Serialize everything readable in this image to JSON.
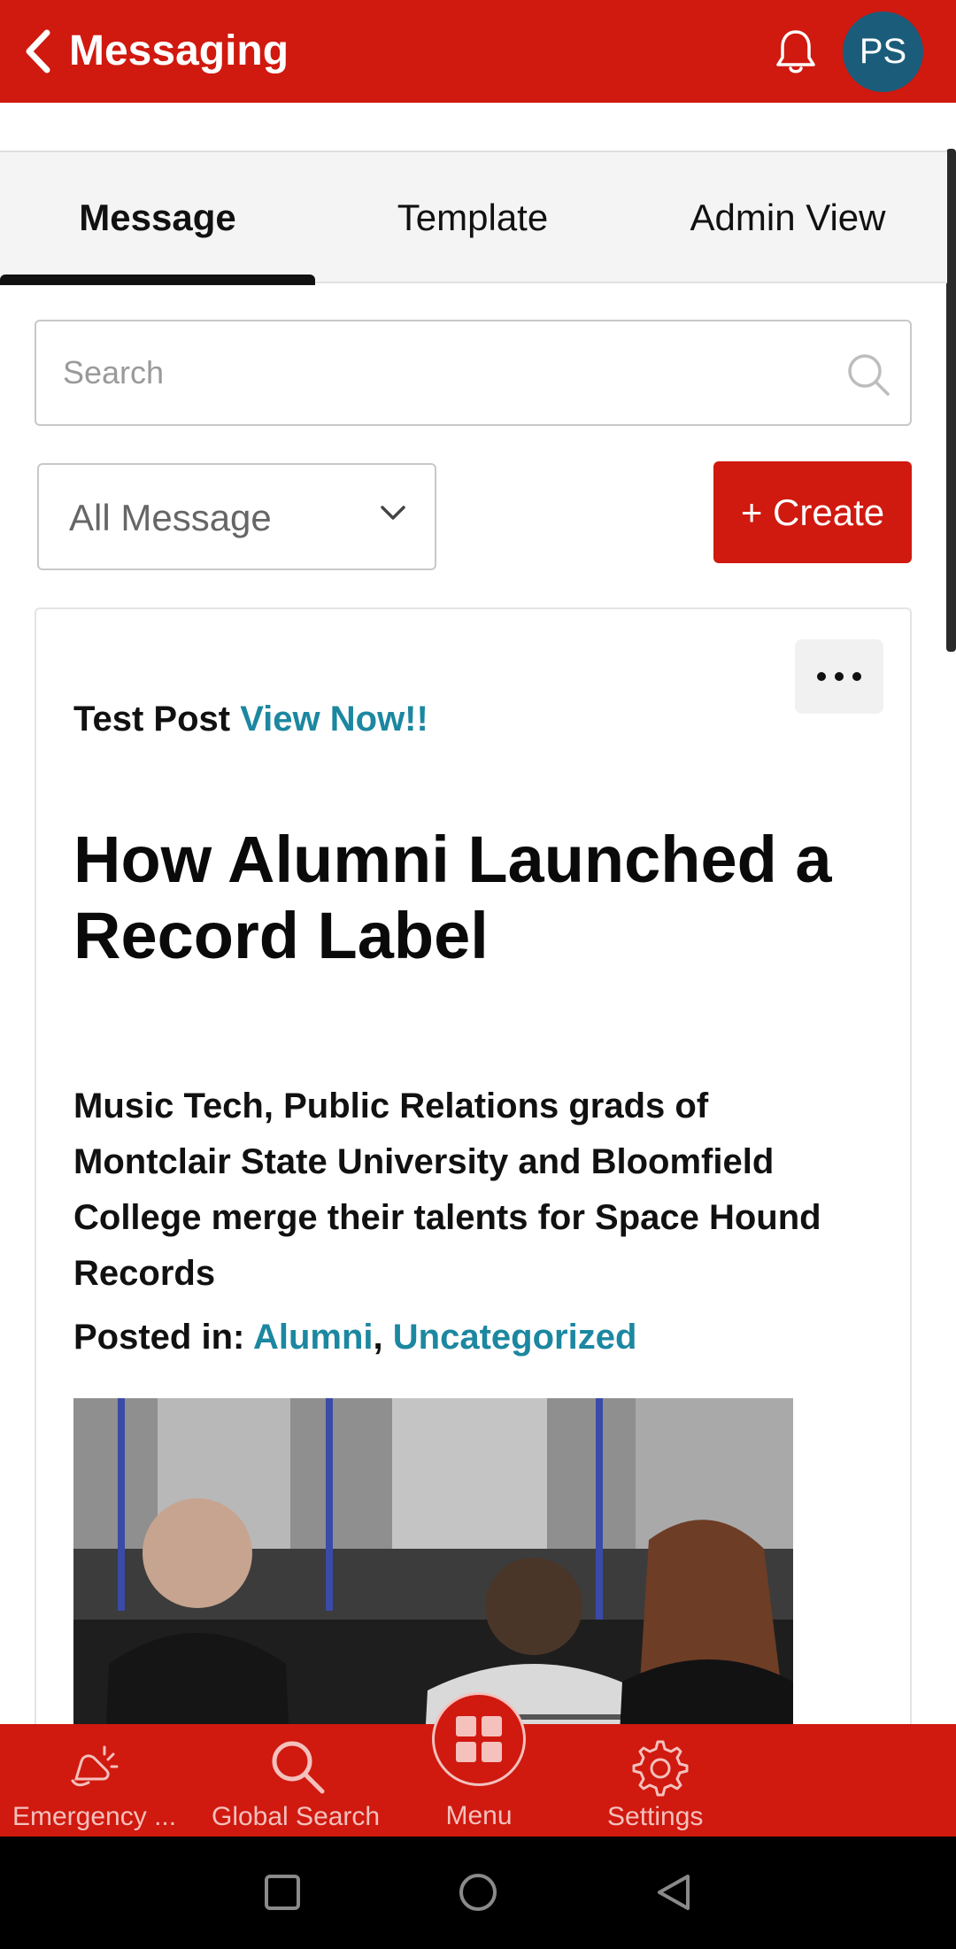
{
  "header": {
    "title": "Messaging",
    "avatar_initials": "PS",
    "color": "#d0190f"
  },
  "tabs": [
    {
      "label": "Message",
      "active": true
    },
    {
      "label": "Template",
      "active": false
    },
    {
      "label": "Admin View",
      "active": false
    }
  ],
  "search": {
    "placeholder": "Search",
    "value": ""
  },
  "filter": {
    "selected": "All Message"
  },
  "create_button": {
    "label": "+ Create"
  },
  "message_card": {
    "post_prefix": "Test Post",
    "post_link": "View Now!!",
    "article_title": "How Alumni Launched a Record Label",
    "article_subtitle": "Music Tech, Public Relations grads of Montclair State University and Bloomfield College merge their talents for Space Hound Records",
    "posted_in_label": "Posted in:",
    "categories": [
      "Alumni",
      "Uncategorized"
    ],
    "category_separator": ",",
    "link_color": "#1c87a0"
  },
  "bottom_nav": {
    "items": [
      {
        "label": "Emergency ...",
        "icon": "emergency-siren-icon"
      },
      {
        "label": "Global Search",
        "icon": "search-icon"
      },
      {
        "label": "Menu",
        "icon": "grid-menu-icon"
      },
      {
        "label": "Settings",
        "icon": "gear-icon"
      }
    ]
  },
  "system_nav": {
    "icons": [
      "recents-square-icon",
      "home-circle-icon",
      "back-triangle-icon"
    ]
  }
}
